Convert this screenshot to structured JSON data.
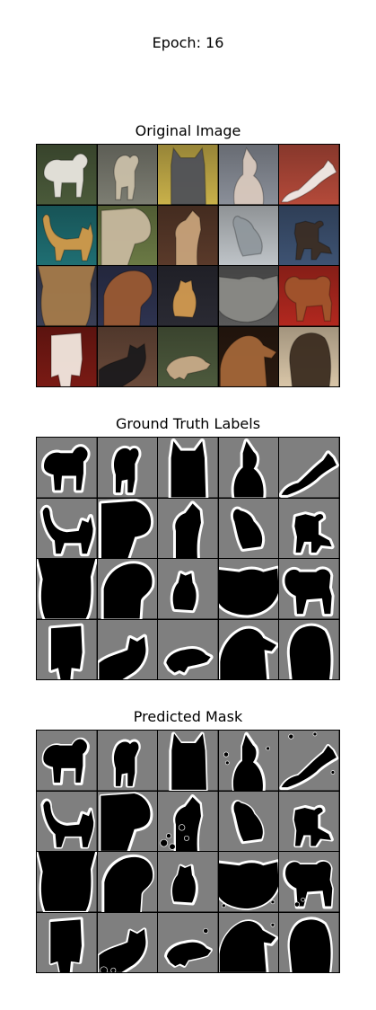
{
  "epoch_title": "Epoch: 16",
  "panels": [
    {
      "id": "original",
      "title": "Original Image"
    },
    {
      "id": "ground_truth",
      "title": "Ground Truth Labels"
    },
    {
      "id": "predicted",
      "title": "Predicted Mask"
    }
  ],
  "colors": {
    "mask_background": "#7f7f7f",
    "mask_foreground": "#000000",
    "mask_border": "#ffffff"
  },
  "original_tiles": [
    {
      "subject": "white bulldog on grass",
      "bg": "#4a5a3a",
      "fg": "#e9e6df"
    },
    {
      "subject": "grey dog standing",
      "bg": "#7c7d72",
      "fg": "#c9bfa8"
    },
    {
      "subject": "grey cat on yellow",
      "bg": "#c9b14a",
      "fg": "#4f5158"
    },
    {
      "subject": "sphynx cat",
      "bg": "#8a8f99",
      "fg": "#d8c8bd"
    },
    {
      "subject": "cat on red blanket",
      "bg": "#b44a3a",
      "fg": "#f0ece8"
    },
    {
      "subject": "bengal cat on teal",
      "bg": "#1f6f73",
      "fg": "#d29a4a"
    },
    {
      "subject": "pug face",
      "bg": "#6b7a45",
      "fg": "#c7b89e"
    },
    {
      "subject": "dog in leaves",
      "bg": "#5a3a2a",
      "fg": "#c7a27a"
    },
    {
      "subject": "russian blue cat",
      "bg": "#bfc4c8",
      "fg": "#8f979c"
    },
    {
      "subject": "dog on blue",
      "bg": "#3e5373",
      "fg": "#3b2d24"
    },
    {
      "subject": "yorkshire terrier",
      "bg": "#3a3f55",
      "fg": "#a47a4a"
    },
    {
      "subject": "boxer dog face",
      "bg": "#2e3350",
      "fg": "#9a5a33"
    },
    {
      "subject": "dog at beach sunset",
      "bg": "#2a2a33",
      "fg": "#d29a50"
    },
    {
      "subject": "grey cat face",
      "bg": "#5a5a5a",
      "fg": "#8a8a86"
    },
    {
      "subject": "boxer on red",
      "bg": "#b2281f",
      "fg": "#a0552c"
    },
    {
      "subject": "puppy on red",
      "bg": "#7a1a14",
      "fg": "#f1e7de"
    },
    {
      "subject": "black cat on couch",
      "bg": "#6a4a3a",
      "fg": "#1b1a1c"
    },
    {
      "subject": "dog lying outdoors",
      "bg": "#4d5a3d",
      "fg": "#c8ab88"
    },
    {
      "subject": "boxer in dark",
      "bg": "#2a1a10",
      "fg": "#a36639"
    },
    {
      "subject": "fluffy dog",
      "bg": "#d9c6a8",
      "fg": "#3b2c20"
    }
  ]
}
